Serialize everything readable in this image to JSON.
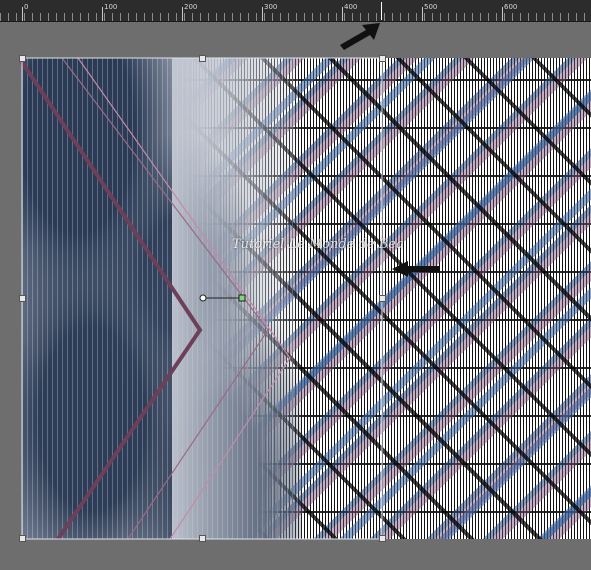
{
  "ruler": {
    "labels": [
      "0",
      "100",
      "200",
      "300",
      "400",
      "500",
      "600"
    ]
  },
  "canvas": {
    "watermark": "Tutoriel Le Monde de Bea",
    "colors": {
      "chevron": "#8a5a74",
      "guide": "#cfe0f0",
      "arrow": "#111111"
    }
  },
  "annotations": {
    "arrow_top": "arrow-icon",
    "arrow_right": "arrow-icon"
  }
}
